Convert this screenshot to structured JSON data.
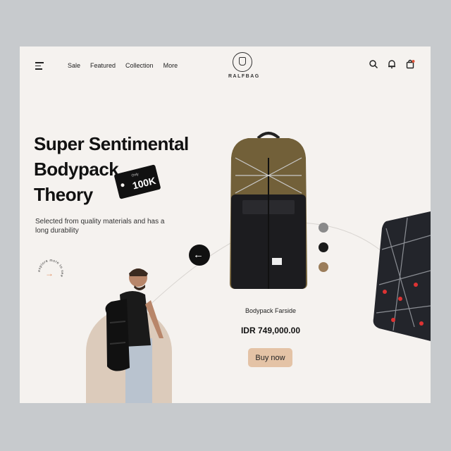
{
  "nav": {
    "items": [
      "Sale",
      "Featured",
      "Collection",
      "More"
    ]
  },
  "brand": {
    "name": "RALFBAG"
  },
  "hero": {
    "title_lines": [
      "Super Sentimental",
      "Bodypack",
      "Theory"
    ],
    "tag": {
      "small": "Only",
      "big": "100K"
    },
    "description": "Selected from quality materials and has a long durability",
    "badge_text": "explore more to see",
    "badge_arrow": "→"
  },
  "product": {
    "name": "Bodypack Farside",
    "price": "IDR 749,000.00",
    "buy_label": "Buy now",
    "colors": [
      "#8a8a8a",
      "#1b1b1b",
      "#9b7d5a"
    ]
  },
  "controls": {
    "prev_arrow": "←"
  },
  "icons": [
    "menu-icon",
    "search-icon",
    "bell-icon",
    "bag-icon"
  ]
}
